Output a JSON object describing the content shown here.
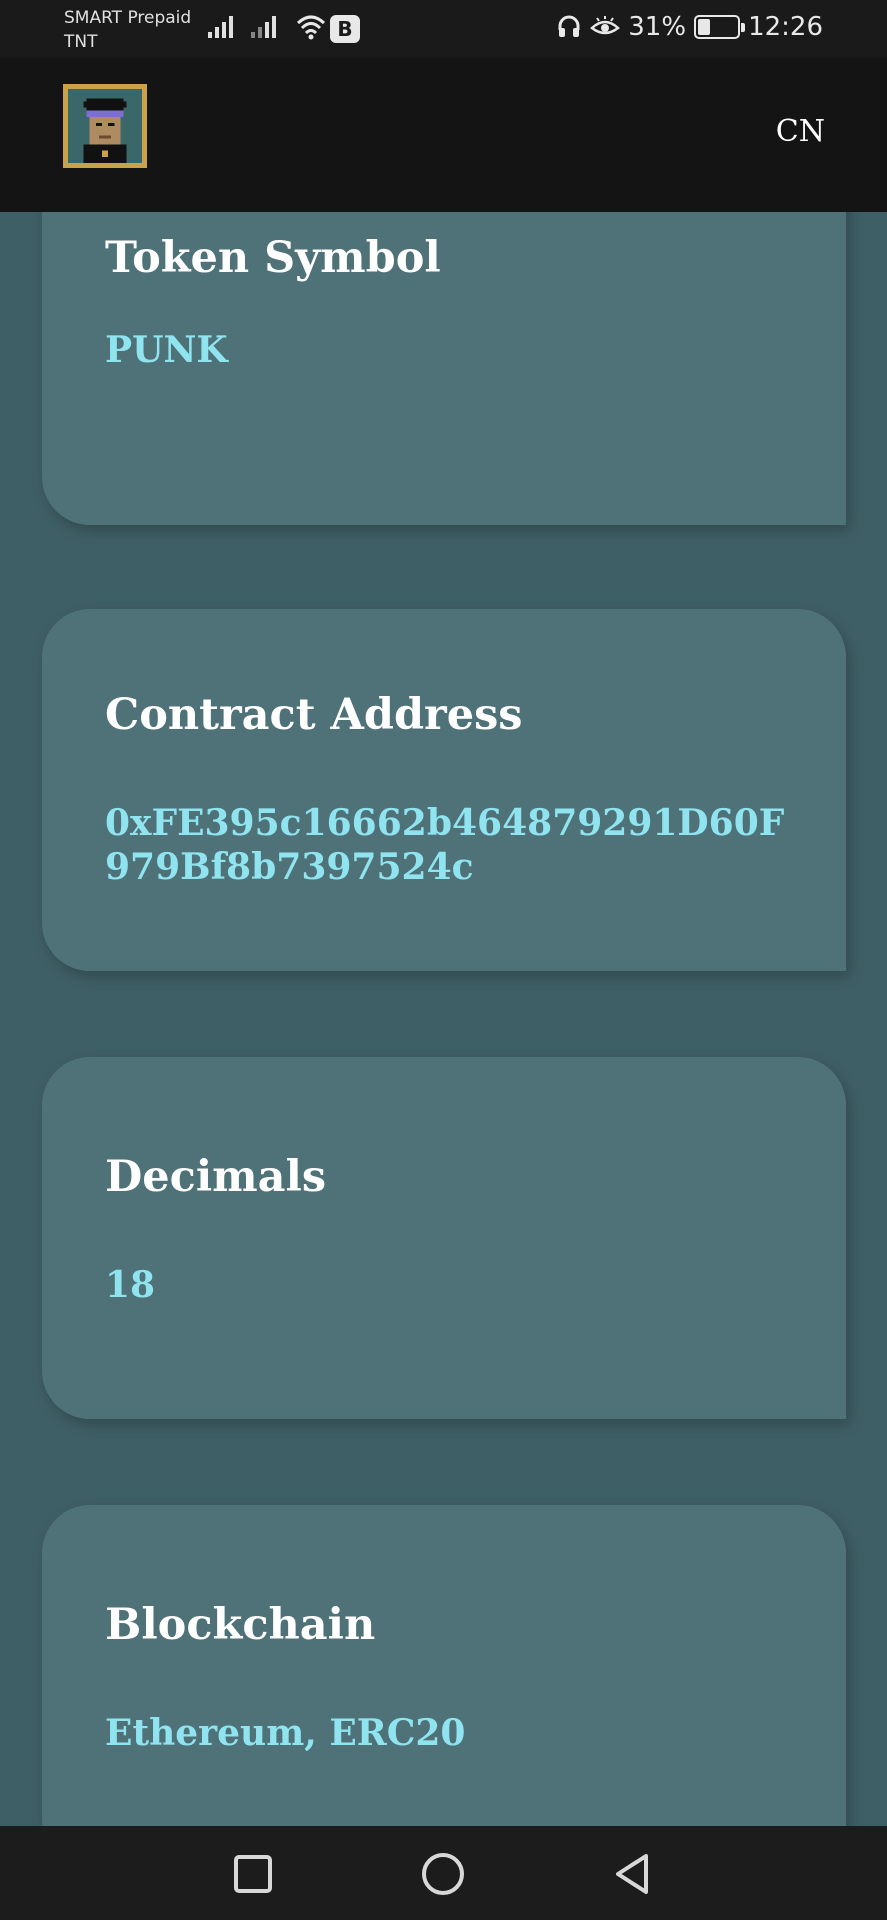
{
  "status_bar": {
    "carrier_line1": "SMART Prepaid",
    "carrier_line2": "TNT",
    "badge": "B",
    "battery_percent": "31%",
    "battery_level": 0.31,
    "time": "12:26"
  },
  "header": {
    "language_label": "CN"
  },
  "cards": [
    {
      "title": "Token Symbol",
      "value": "PUNK"
    },
    {
      "title": "Contract Address",
      "value": "0xFE395c16662b464879291D60F979Bf8b7397524c"
    },
    {
      "title": "Decimals",
      "value": "18"
    },
    {
      "title": "Blockchain",
      "value": "Ethereum, ERC20"
    }
  ],
  "colors": {
    "page_background": "#3f5f66",
    "card_background": "#4f7278",
    "value_text": "#8fe4f0",
    "title_text": "#ffffff",
    "header_background": "#141414",
    "avatar_frame": "#c9a24a"
  },
  "icons": {
    "signal": "signal-bars-icon",
    "wifi": "wifi-icon",
    "headphones": "headphones-icon",
    "eye": "eye-comfort-icon",
    "battery": "battery-icon",
    "nav_recent": "square-recents-icon",
    "nav_home": "circle-home-icon",
    "nav_back": "triangle-back-icon"
  }
}
